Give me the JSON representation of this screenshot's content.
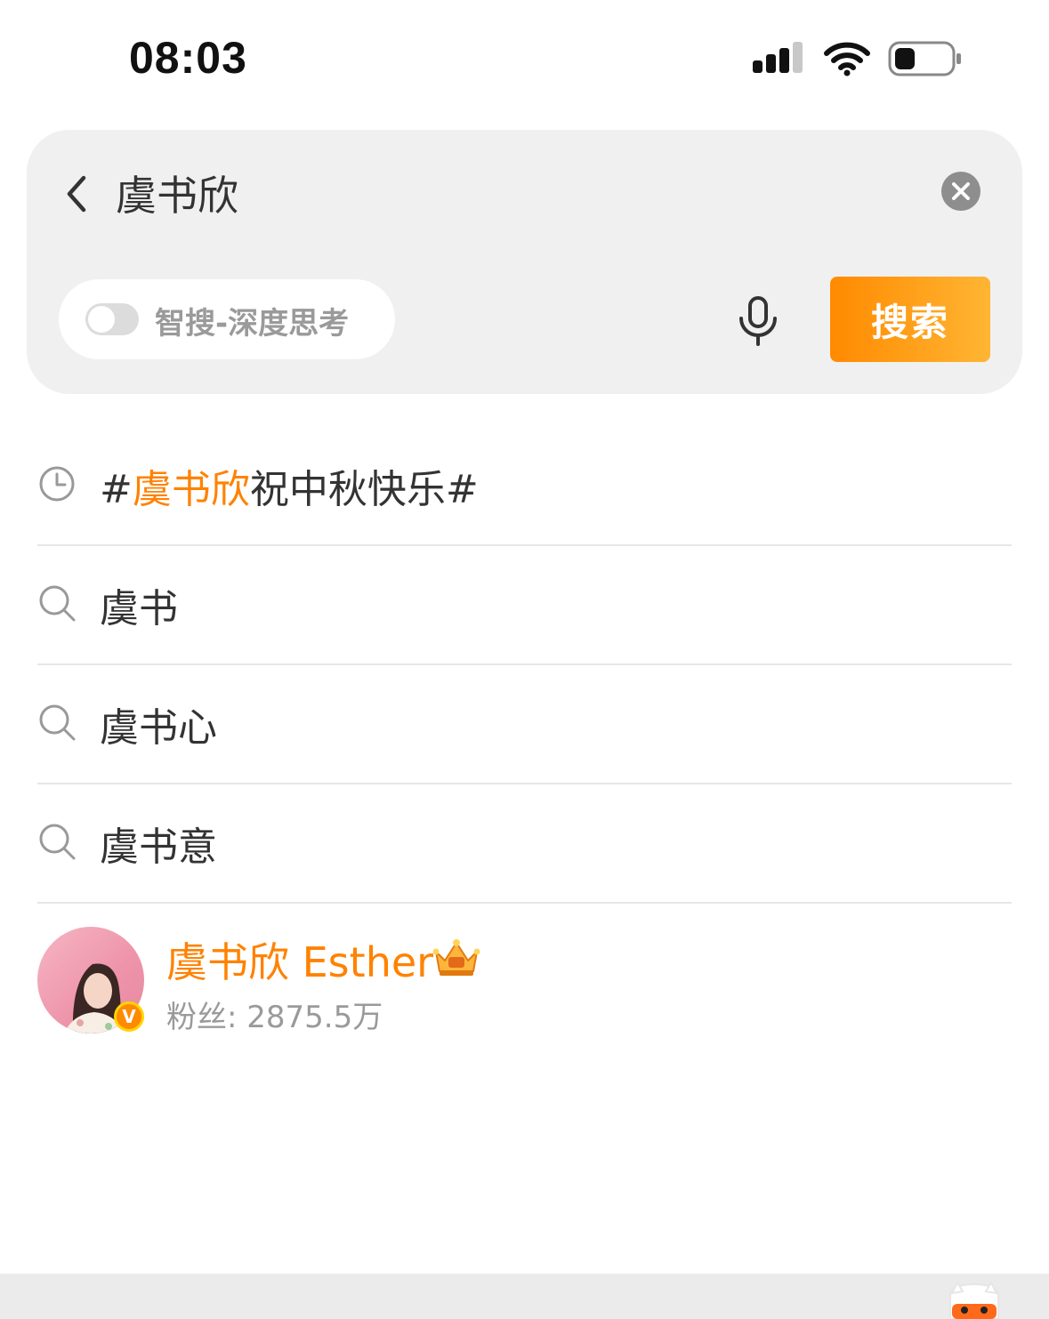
{
  "status_bar": {
    "time": "08:03"
  },
  "search": {
    "back_icon": "chevron-left-icon",
    "query": "虞书欣",
    "clear_icon": "close-circle-icon",
    "smart_search_label": "智搜-深度思考",
    "smart_search_enabled": false,
    "mic_icon": "microphone-icon",
    "search_button_label": "搜索",
    "accent_color": "#ff8200"
  },
  "suggestions": [
    {
      "icon": "history-clock-icon",
      "prefix": "#",
      "highlight": "虞书欣",
      "rest": "祝中秋快乐#"
    },
    {
      "icon": "search-icon",
      "text": "虞书"
    },
    {
      "icon": "search-icon",
      "text": "虞书心"
    },
    {
      "icon": "search-icon",
      "text": "虞书意"
    }
  ],
  "user_result": {
    "name": "虞书欣 Esther",
    "fans": "粉丝: 2875.5万",
    "verified_badge": "V",
    "crown_icon": "crown-icon"
  },
  "bottom_bar": {
    "mascot_icon": "mascot-icon"
  }
}
